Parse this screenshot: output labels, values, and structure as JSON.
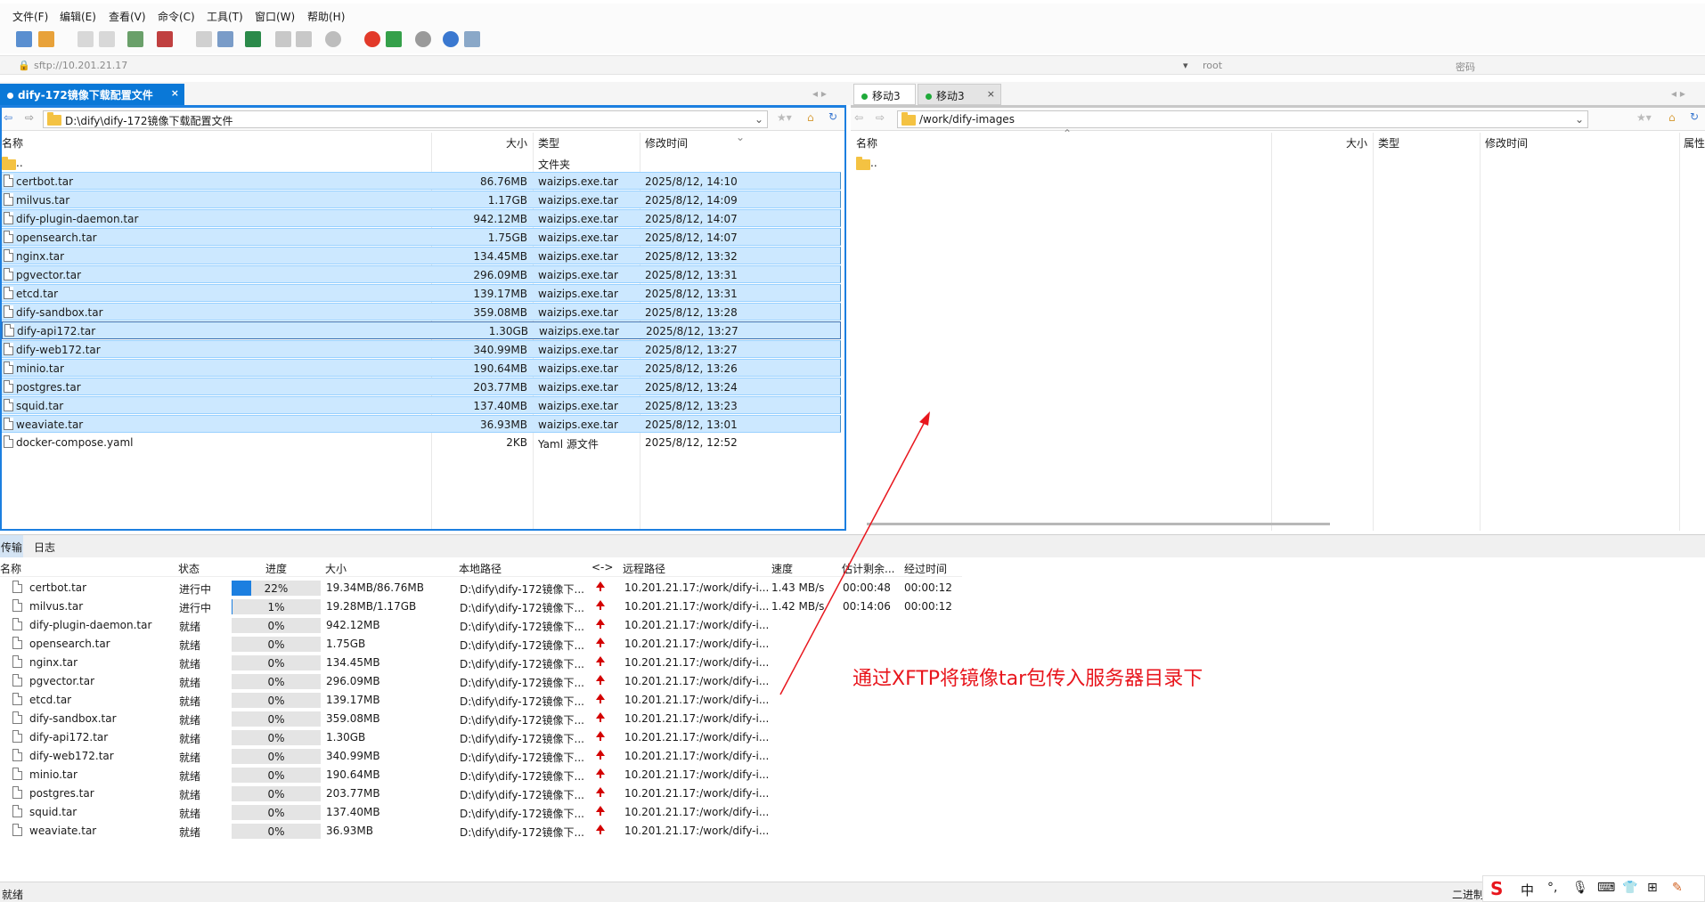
{
  "colors": {
    "accent": "#1c7fe0",
    "selection": "#cce8ff",
    "annotation": "#e8161d",
    "active_tab": "#0a78d7"
  },
  "menu": [
    "文件(F)",
    "编辑(E)",
    "查看(V)",
    "命令(C)",
    "工具(T)",
    "窗口(W)",
    "帮助(H)"
  ],
  "address": {
    "url": "sftp://10.201.21.17",
    "user": "root",
    "password_placeholder": "密码"
  },
  "left_tab": {
    "label": "dify-172镜像下载配置文件",
    "close": "×"
  },
  "right_tabs": [
    {
      "label": "移动3",
      "close": ""
    },
    {
      "label": "移动3",
      "close": "×"
    }
  ],
  "left_pane": {
    "path": "D:\\dify\\dify-172镜像下载配置文件",
    "columns": [
      "名称",
      "大小",
      "类型",
      "修改时间"
    ],
    "parent": {
      "name": "..",
      "type": "文件夹"
    },
    "files": [
      {
        "name": "certbot.tar",
        "size": "86.76MB",
        "type": "waizips.exe.tar",
        "mtime": "2025/8/12, 14:10"
      },
      {
        "name": "milvus.tar",
        "size": "1.17GB",
        "type": "waizips.exe.tar",
        "mtime": "2025/8/12, 14:09"
      },
      {
        "name": "dify-plugin-daemon.tar",
        "size": "942.12MB",
        "type": "waizips.exe.tar",
        "mtime": "2025/8/12, 14:07"
      },
      {
        "name": "opensearch.tar",
        "size": "1.75GB",
        "type": "waizips.exe.tar",
        "mtime": "2025/8/12, 14:07"
      },
      {
        "name": "nginx.tar",
        "size": "134.45MB",
        "type": "waizips.exe.tar",
        "mtime": "2025/8/12, 13:32"
      },
      {
        "name": "pgvector.tar",
        "size": "296.09MB",
        "type": "waizips.exe.tar",
        "mtime": "2025/8/12, 13:31"
      },
      {
        "name": "etcd.tar",
        "size": "139.17MB",
        "type": "waizips.exe.tar",
        "mtime": "2025/8/12, 13:31"
      },
      {
        "name": "dify-sandbox.tar",
        "size": "359.08MB",
        "type": "waizips.exe.tar",
        "mtime": "2025/8/12, 13:28"
      },
      {
        "name": "dify-api172.tar",
        "size": "1.30GB",
        "type": "waizips.exe.tar",
        "mtime": "2025/8/12, 13:27"
      },
      {
        "name": "dify-web172.tar",
        "size": "340.99MB",
        "type": "waizips.exe.tar",
        "mtime": "2025/8/12, 13:27"
      },
      {
        "name": "minio.tar",
        "size": "190.64MB",
        "type": "waizips.exe.tar",
        "mtime": "2025/8/12, 13:26"
      },
      {
        "name": "postgres.tar",
        "size": "203.77MB",
        "type": "waizips.exe.tar",
        "mtime": "2025/8/12, 13:24"
      },
      {
        "name": "squid.tar",
        "size": "137.40MB",
        "type": "waizips.exe.tar",
        "mtime": "2025/8/12, 13:23"
      },
      {
        "name": "weaviate.tar",
        "size": "36.93MB",
        "type": "waizips.exe.tar",
        "mtime": "2025/8/12, 13:01"
      },
      {
        "name": "docker-compose.yaml",
        "size": "2KB",
        "type": "Yaml 源文件",
        "mtime": "2025/8/12, 12:52"
      }
    ]
  },
  "right_pane": {
    "path": "/work/dify-images",
    "columns": [
      "名称",
      "大小",
      "类型",
      "修改时间",
      "属性"
    ],
    "parent": ".."
  },
  "bottom_tabs": [
    "传输",
    "日志"
  ],
  "transfer": {
    "columns": [
      "名称",
      "状态",
      "进度",
      "大小",
      "本地路径",
      "<->",
      "远程路径",
      "速度",
      "估计剩余...",
      "经过时间"
    ],
    "rows": [
      {
        "name": "certbot.tar",
        "status": "进行中",
        "progress": 22,
        "progress_label": "22%",
        "size": "19.34MB/86.76MB",
        "local": "D:\\dify\\dify-172镜像下...",
        "remote": "10.201.21.17:/work/dify-i...",
        "speed": "1.43 MB/s",
        "eta": "00:00:48",
        "elapsed": "00:00:12"
      },
      {
        "name": "milvus.tar",
        "status": "进行中",
        "progress": 1,
        "progress_label": "1%",
        "size": "19.28MB/1.17GB",
        "local": "D:\\dify\\dify-172镜像下...",
        "remote": "10.201.21.17:/work/dify-i...",
        "speed": "1.42 MB/s",
        "eta": "00:14:06",
        "elapsed": "00:00:12"
      },
      {
        "name": "dify-plugin-daemon.tar",
        "status": "就绪",
        "progress": 0,
        "progress_label": "0%",
        "size": "942.12MB",
        "local": "D:\\dify\\dify-172镜像下...",
        "remote": "10.201.21.17:/work/dify-i...",
        "speed": "",
        "eta": "",
        "elapsed": ""
      },
      {
        "name": "opensearch.tar",
        "status": "就绪",
        "progress": 0,
        "progress_label": "0%",
        "size": "1.75GB",
        "local": "D:\\dify\\dify-172镜像下...",
        "remote": "10.201.21.17:/work/dify-i...",
        "speed": "",
        "eta": "",
        "elapsed": ""
      },
      {
        "name": "nginx.tar",
        "status": "就绪",
        "progress": 0,
        "progress_label": "0%",
        "size": "134.45MB",
        "local": "D:\\dify\\dify-172镜像下...",
        "remote": "10.201.21.17:/work/dify-i...",
        "speed": "",
        "eta": "",
        "elapsed": ""
      },
      {
        "name": "pgvector.tar",
        "status": "就绪",
        "progress": 0,
        "progress_label": "0%",
        "size": "296.09MB",
        "local": "D:\\dify\\dify-172镜像下...",
        "remote": "10.201.21.17:/work/dify-i...",
        "speed": "",
        "eta": "",
        "elapsed": ""
      },
      {
        "name": "etcd.tar",
        "status": "就绪",
        "progress": 0,
        "progress_label": "0%",
        "size": "139.17MB",
        "local": "D:\\dify\\dify-172镜像下...",
        "remote": "10.201.21.17:/work/dify-i...",
        "speed": "",
        "eta": "",
        "elapsed": ""
      },
      {
        "name": "dify-sandbox.tar",
        "status": "就绪",
        "progress": 0,
        "progress_label": "0%",
        "size": "359.08MB",
        "local": "D:\\dify\\dify-172镜像下...",
        "remote": "10.201.21.17:/work/dify-i...",
        "speed": "",
        "eta": "",
        "elapsed": ""
      },
      {
        "name": "dify-api172.tar",
        "status": "就绪",
        "progress": 0,
        "progress_label": "0%",
        "size": "1.30GB",
        "local": "D:\\dify\\dify-172镜像下...",
        "remote": "10.201.21.17:/work/dify-i...",
        "speed": "",
        "eta": "",
        "elapsed": ""
      },
      {
        "name": "dify-web172.tar",
        "status": "就绪",
        "progress": 0,
        "progress_label": "0%",
        "size": "340.99MB",
        "local": "D:\\dify\\dify-172镜像下...",
        "remote": "10.201.21.17:/work/dify-i...",
        "speed": "",
        "eta": "",
        "elapsed": ""
      },
      {
        "name": "minio.tar",
        "status": "就绪",
        "progress": 0,
        "progress_label": "0%",
        "size": "190.64MB",
        "local": "D:\\dify\\dify-172镜像下...",
        "remote": "10.201.21.17:/work/dify-i...",
        "speed": "",
        "eta": "",
        "elapsed": ""
      },
      {
        "name": "postgres.tar",
        "status": "就绪",
        "progress": 0,
        "progress_label": "0%",
        "size": "203.77MB",
        "local": "D:\\dify\\dify-172镜像下...",
        "remote": "10.201.21.17:/work/dify-i...",
        "speed": "",
        "eta": "",
        "elapsed": ""
      },
      {
        "name": "squid.tar",
        "status": "就绪",
        "progress": 0,
        "progress_label": "0%",
        "size": "137.40MB",
        "local": "D:\\dify\\dify-172镜像下...",
        "remote": "10.201.21.17:/work/dify-i...",
        "speed": "",
        "eta": "",
        "elapsed": ""
      },
      {
        "name": "weaviate.tar",
        "status": "就绪",
        "progress": 0,
        "progress_label": "0%",
        "size": "36.93MB",
        "local": "D:\\dify\\dify-172镜像下...",
        "remote": "10.201.21.17:/work/dify-i...",
        "speed": "",
        "eta": "",
        "elapsed": ""
      }
    ]
  },
  "annotation": "通过XFTP将镜像tar包传入服务器目录下",
  "statusbar": {
    "left": "就绪",
    "right": "二进制"
  },
  "ime": [
    "中",
    "°,",
    "🎙",
    "⌨",
    "👕",
    "⊞",
    "✎"
  ]
}
